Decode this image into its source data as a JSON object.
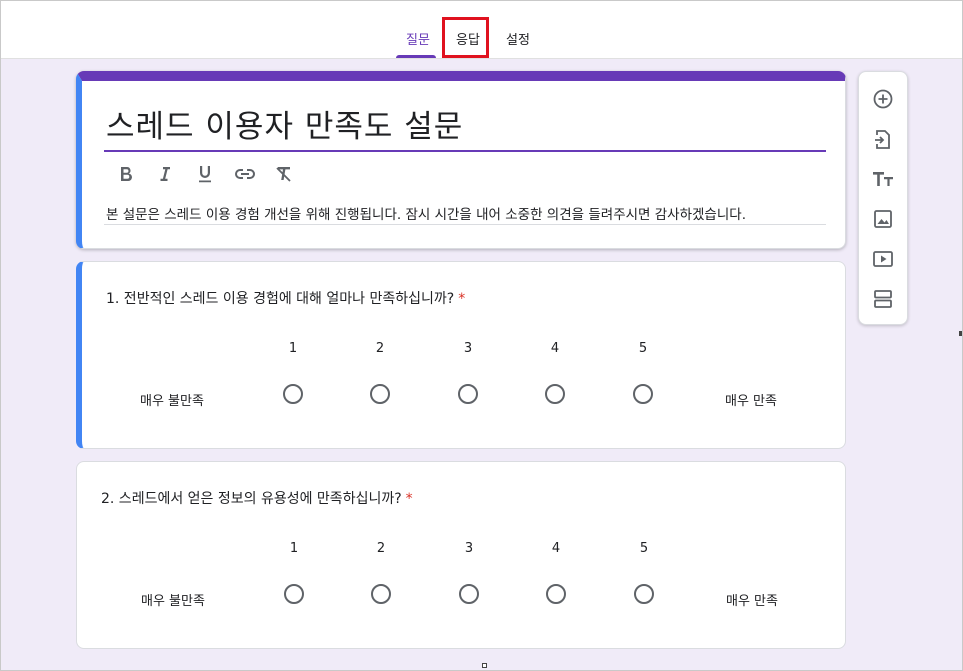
{
  "tabs": {
    "questions": "질문",
    "responses": "응답",
    "settings": "설정"
  },
  "form": {
    "title": "스레드 이용자 만족도 설문",
    "description": "본 설문은 스레드 이용 경험 개선을 위해 진행됩니다. 잠시 시간을 내어 소중한 의견을 들려주시면 감사하겠습니다.",
    "format_icons": [
      "bold-icon",
      "italic-icon",
      "underline-icon",
      "link-icon",
      "clear-format-icon"
    ]
  },
  "questions": [
    {
      "text": "1. 전반적인 스레드 이용 경험에 대해 얼마나 만족하십니까?",
      "required_mark": "*",
      "scale": [
        "1",
        "2",
        "3",
        "4",
        "5"
      ],
      "min_label": "매우 불만족",
      "max_label": "매우 만족"
    },
    {
      "text": "2. 스레드에서 얻은 정보의 유용성에 만족하십니까?",
      "required_mark": "*",
      "scale": [
        "1",
        "2",
        "3",
        "4",
        "5"
      ],
      "min_label": "매우 불만족",
      "max_label": "매우 만족"
    }
  ],
  "sidebar": {
    "icons": [
      "add-question-icon",
      "import-questions-icon",
      "add-title-icon",
      "add-image-icon",
      "add-video-icon",
      "add-section-icon"
    ]
  },
  "colors": {
    "accent": "#673ab7",
    "active_card": "#4285f4",
    "background": "#f0ebf8",
    "required": "#d93025",
    "highlight": "#e0121f"
  }
}
